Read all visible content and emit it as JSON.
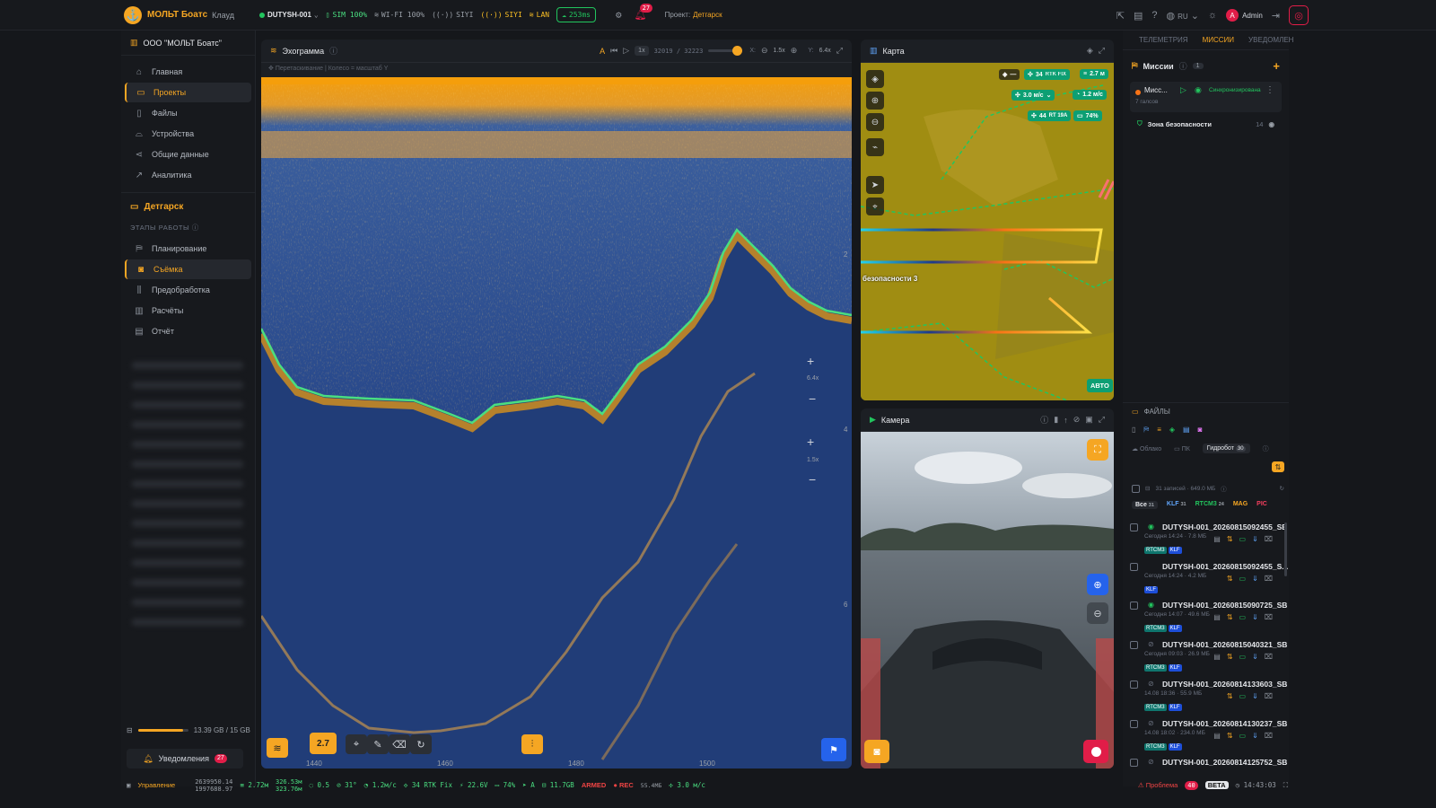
{
  "topbar": {
    "brand": "МОЛЬТ Боатс",
    "brand_sub": "Клауд",
    "device": "DUTYSH-001",
    "sim": "SIM 100%",
    "wifi": "WI-FI 100%",
    "s1": "SIYI",
    "s2": "SIYI",
    "lan": "LAN",
    "cloud": "253ms",
    "notif_count": "27",
    "project_label": "Проект:",
    "project_name": "Детгарск",
    "lang": "RU",
    "user": "Admin",
    "user_initial": "A"
  },
  "sidebar": {
    "org": "ООО \"МОЛЬТ Боатс\"",
    "items": [
      {
        "label": "Главная",
        "icon": "home-icon"
      },
      {
        "label": "Проекты",
        "icon": "folder-icon"
      },
      {
        "label": "Файлы",
        "icon": "files-icon"
      },
      {
        "label": "Устройства",
        "icon": "device-icon"
      },
      {
        "label": "Общие данные",
        "icon": "share-icon"
      },
      {
        "label": "Аналитика",
        "icon": "chart-icon"
      }
    ],
    "project": "Детгарск",
    "stages_header": "ЭТАПЫ РАБОТЫ",
    "stages": [
      {
        "label": "Планирование"
      },
      {
        "label": "Съёмка"
      },
      {
        "label": "Предобработка"
      },
      {
        "label": "Расчёты"
      },
      {
        "label": "Отчёт"
      }
    ],
    "storage": "13.39 GB / 15 GB",
    "storage_fraction": 0.89,
    "notif_label": "Уведомления",
    "notif_count": "27"
  },
  "echogram": {
    "title": "Эхограмма",
    "subtitle": "Перетаскивание | Колесо = масштаб Y",
    "speed": "1x",
    "frame": "32019 / 32223",
    "x_zoom_label": "X:",
    "x_zoom": "1.5x",
    "y_zoom_label": "Y:",
    "y_zoom": "6.4x",
    "zoom_y": "6.4x",
    "zoom_x": "1.5x",
    "x_ticks": [
      "1440",
      "1460",
      "1480",
      "1500"
    ],
    "y_ticks": [
      "2",
      "4",
      "6"
    ],
    "gain": "2.7"
  },
  "map": {
    "title": "Карта",
    "sats": "34",
    "rtk": "RTK FIX",
    "depth": "2.7 м",
    "wind": "3.0 м/с",
    "speed": "1.2 м/с",
    "b44": "44",
    "b44sub": "RT 19A",
    "battery": "74%",
    "zone_label": "безопасности 3",
    "mode": "АВТО"
  },
  "camera": {
    "title": "Камера"
  },
  "right": {
    "tabs": [
      "ТЕЛЕМЕТРИЯ",
      "МИССИИ",
      "УВЕДОМЛЕН"
    ],
    "missions_title": "Миссии",
    "missions_count": "1",
    "mission_name": "Мисс...",
    "mission_status": "Синхронизирована",
    "mission_sub": "7 галсов",
    "zone": "Зона безопасности",
    "zone_num": "14",
    "files_title": "ФАЙЛЫ",
    "src_tabs": [
      "Облако",
      "ПК",
      "Гидробот"
    ],
    "src_count": "30",
    "summary": "31 записей · 649.0 МБ",
    "filter": [
      {
        "label": "Все",
        "count": "31"
      },
      {
        "label": "KLF",
        "count": "31"
      },
      {
        "label": "RTCM3",
        "count": "24"
      },
      {
        "label": "MAG",
        "count": ""
      },
      {
        "label": "PIC",
        "count": ""
      }
    ],
    "files": [
      {
        "name": "DUTYSH-001_20260815092455_SB",
        "meta": "Сегодня 14:24 · 7.8 МБ"
      },
      {
        "name": "DUTYSH-001_20260815092455_S...",
        "meta": "Сегодня 14:24 · 4.2 МБ"
      },
      {
        "name": "DUTYSH-001_20260815090725_SB",
        "meta": "Сегодня 14:07 · 49.6 МБ"
      },
      {
        "name": "DUTYSH-001_20260815040321_SB",
        "meta": "Сегодня 09:03 · 26.9 МБ"
      },
      {
        "name": "DUTYSH-001_20260814133603_SB",
        "meta": "14.08 18:36 · 55.9 МБ"
      },
      {
        "name": "DUTYSH-001_20260814130237_SB",
        "meta": "14.08 18:02 · 234.0 МБ"
      },
      {
        "name": "DUTYSH-001_20260814125752_SB",
        "meta": ""
      }
    ]
  },
  "bottom": {
    "control": "Управление",
    "coords1": "2639950.14",
    "coords2": "1997688.97",
    "depth": "2.72м",
    "alt1": "326.53м",
    "alt2": "323.76м",
    "v1": "0.5",
    "heading": "31°",
    "speed": "1.2м/с",
    "rtk": "34 RTK Fix",
    "volt": "22.6V",
    "batt": "74%",
    "mode": "А",
    "storage": "11.7GB",
    "armed": "ARMED",
    "rec": "REC",
    "rec_sub": "55.4МБ",
    "wind": "3.0 м/с",
    "problem": "Проблема",
    "problem_count": "40",
    "beta": "BETA",
    "time": "14:43:03"
  }
}
